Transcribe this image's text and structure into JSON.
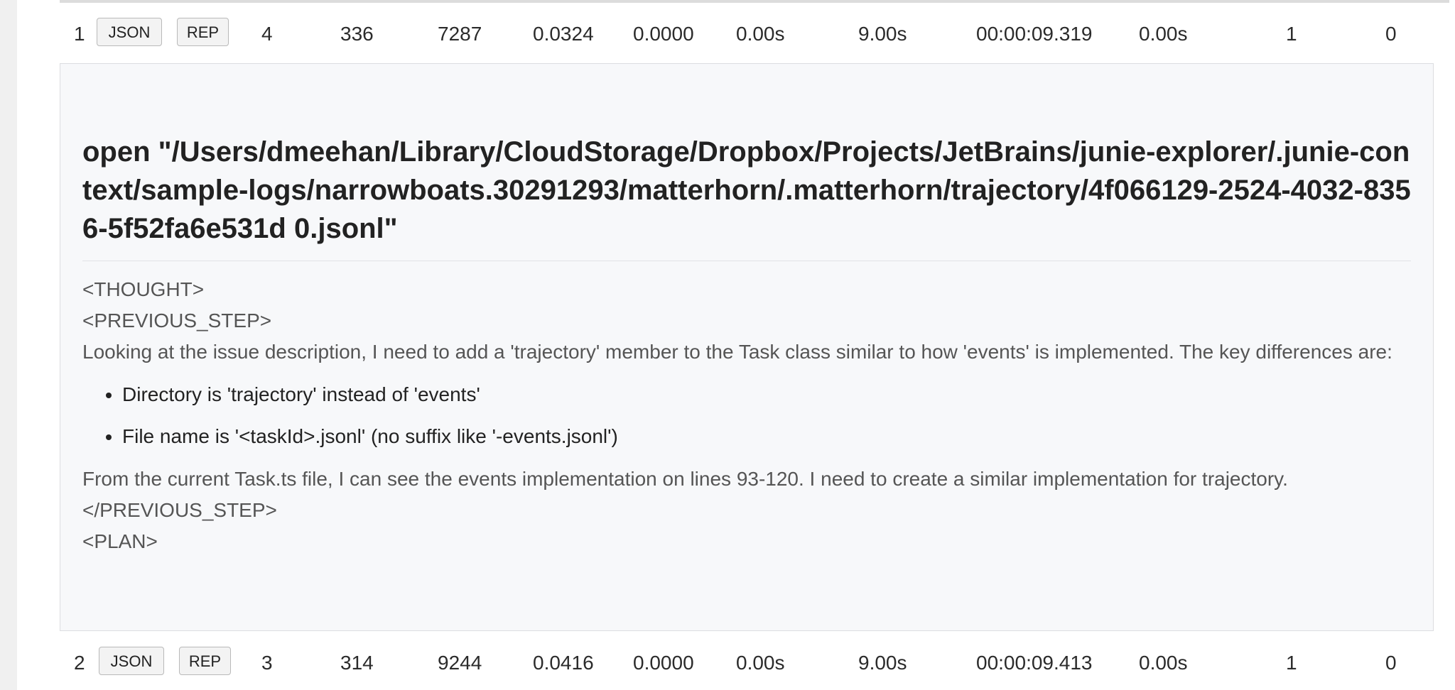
{
  "rows": [
    {
      "index": "1",
      "json_label": "JSON",
      "rep_label": "REP",
      "c1": "4",
      "c2": "336",
      "c3": "7287",
      "c4": "0.0324",
      "c5": "0.0000",
      "c6": "0.00s",
      "c7": "9.00s",
      "c8": "00:00:09.319",
      "c9": "0.00s",
      "c10": "1",
      "c11": "0"
    },
    {
      "index": "2",
      "json_label": "JSON",
      "rep_label": "REP",
      "c1": "3",
      "c2": "314",
      "c3": "9244",
      "c4": "0.0416",
      "c5": "0.0000",
      "c6": "0.00s",
      "c7": "9.00s",
      "c8": "00:00:09.413",
      "c9": "0.00s",
      "c10": "1",
      "c11": "0"
    }
  ],
  "detail": {
    "title": "open \"/Users/dmeehan/Library/CloudStorage/Dropbox/Projects/JetBrains/junie-explorer/.junie-context/sample-logs/narrowboats.30291293/matterhorn/.matterhorn/trajectory/4f066129-2524-4032-8356-5f52fa6e531d 0.jsonl\"",
    "thought_open": "<THOUGHT>",
    "prev_step_open": "<PREVIOUS_STEP>",
    "intro": "Looking at the issue description, I need to add a 'trajectory' member to the Task class similar to how 'events' is implemented. The key differences are:",
    "bullets": [
      "Directory is 'trajectory' instead of 'events'",
      "File name is '<taskId>.jsonl' (no suffix like '-events.jsonl')"
    ],
    "from_text": "From the current Task.ts file, I can see the events implementation on lines 93-120. I need to create a similar implementation for trajectory.",
    "prev_step_close": "</PREVIOUS_STEP>",
    "plan_open": "<PLAN>"
  }
}
